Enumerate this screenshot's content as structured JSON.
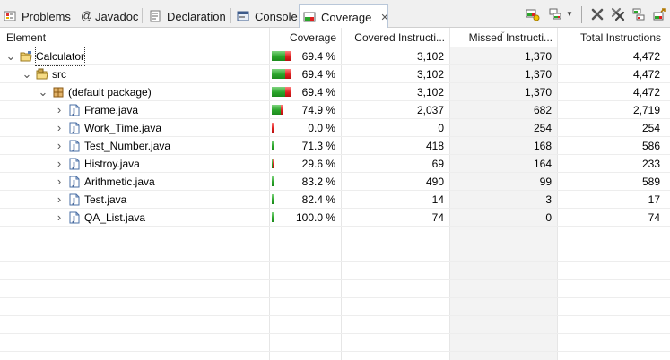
{
  "tabs": [
    {
      "label": "Problems",
      "icon": "problems-icon",
      "active": false
    },
    {
      "label": "Javadoc",
      "icon": "javadoc-icon",
      "active": false
    },
    {
      "label": "Declaration",
      "icon": "declaration-icon",
      "active": false
    },
    {
      "label": "Console",
      "icon": "console-icon",
      "active": false
    },
    {
      "label": "Coverage",
      "icon": "coverage-icon",
      "active": true
    }
  ],
  "toolbar": {
    "icons": [
      "coverage-relaunch-icon",
      "show-mode-icon",
      "view-menu-icon",
      "remove-session-icon",
      "remove-all-sessions-icon",
      "merge-sessions-icon",
      "export-session-icon"
    ]
  },
  "columns": [
    "Element",
    "Coverage",
    "Covered Instructi...",
    "Missed Instructi...",
    "Total Instructions"
  ],
  "colors": {
    "covered": "#2aa52a",
    "missed": "#e02020",
    "sorted_column_bg": "#f3f3f3"
  },
  "rows": [
    {
      "name": "Calculator",
      "icon": "project-folder-icon",
      "level": 0,
      "coverage": "69.4 %",
      "covered": "3,102",
      "missed": "1,370",
      "total": "4,472",
      "bar_fraction": 0.694,
      "bar_total_share": 1.0,
      "focused": true
    },
    {
      "name": "src",
      "icon": "source-folder-icon",
      "level": 1,
      "coverage": "69.4 %",
      "covered": "3,102",
      "missed": "1,370",
      "total": "4,472",
      "bar_fraction": 0.694,
      "bar_total_share": 1.0
    },
    {
      "name": "(default package)",
      "icon": "package-icon",
      "level": 2,
      "coverage": "69.4 %",
      "covered": "3,102",
      "missed": "1,370",
      "total": "4,472",
      "bar_fraction": 0.694,
      "bar_total_share": 1.0
    },
    {
      "name": "Frame.java",
      "icon": "java-file-icon",
      "level": 3,
      "coverage": "74.9 %",
      "covered": "2,037",
      "missed": "682",
      "total": "2,719",
      "bar_fraction": 0.749,
      "bar_total_share": 0.608
    },
    {
      "name": "Work_Time.java",
      "icon": "java-file-icon",
      "level": 3,
      "coverage": "0.0 %",
      "covered": "0",
      "missed": "254",
      "total": "254",
      "bar_fraction": 0.0,
      "bar_total_share": 0.057
    },
    {
      "name": "Test_Number.java",
      "icon": "java-file-icon",
      "level": 3,
      "coverage": "71.3 %",
      "covered": "418",
      "missed": "168",
      "total": "586",
      "bar_fraction": 0.713,
      "bar_total_share": 0.131
    },
    {
      "name": "Histroy.java",
      "icon": "java-file-icon",
      "level": 3,
      "coverage": "29.6 %",
      "covered": "69",
      "missed": "164",
      "total": "233",
      "bar_fraction": 0.296,
      "bar_total_share": 0.052
    },
    {
      "name": "Arithmetic.java",
      "icon": "java-file-icon",
      "level": 3,
      "coverage": "83.2 %",
      "covered": "490",
      "missed": "99",
      "total": "589",
      "bar_fraction": 0.832,
      "bar_total_share": 0.132
    },
    {
      "name": "Test.java",
      "icon": "java-file-icon",
      "level": 3,
      "coverage": "82.4 %",
      "covered": "14",
      "missed": "3",
      "total": "17",
      "bar_fraction": 0.824,
      "bar_total_share": 0.004
    },
    {
      "name": "QA_List.java",
      "icon": "java-file-icon",
      "level": 3,
      "coverage": "100.0 %",
      "covered": "74",
      "missed": "0",
      "total": "74",
      "bar_fraction": 1.0,
      "bar_total_share": 0.017
    }
  ]
}
